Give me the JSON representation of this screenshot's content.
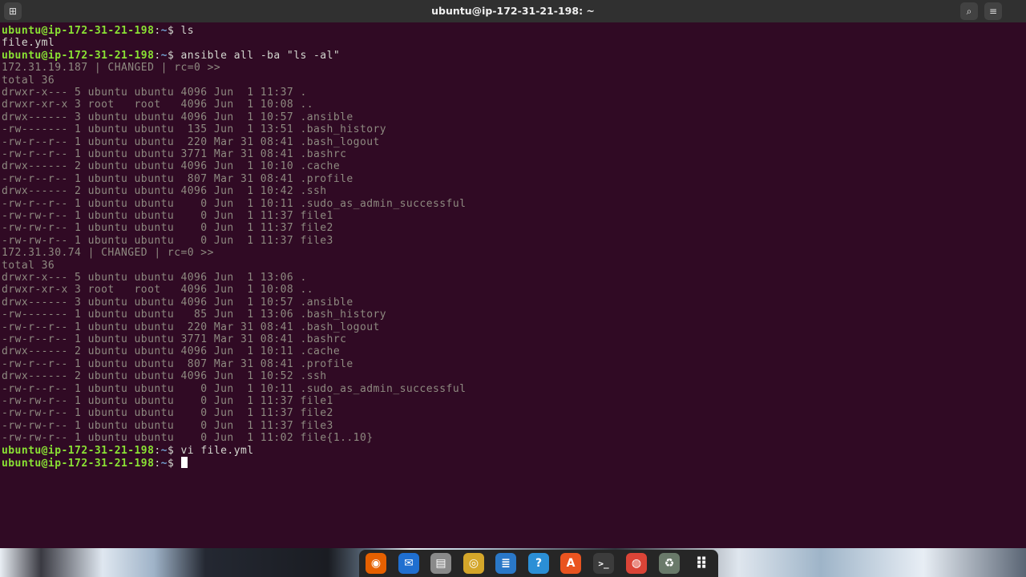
{
  "window": {
    "title": "ubuntu@ip-172-31-21-198: ~"
  },
  "terminal": {
    "prompt_user": "ubuntu@ip-172-31-21-198",
    "prompt_sep": ":",
    "prompt_path": "~",
    "prompt_symbol": "$",
    "commands": {
      "ls": " ls",
      "ansible": " ansible all -ba \"ls -al\"",
      "vi": " vi file.yml"
    },
    "ls_output": "file.yml",
    "host1_header": "172.31.19.187 | CHANGED | rc=0 >>",
    "host1_total": "total 36",
    "host1_lines": [
      "drwxr-x--- 5 ubuntu ubuntu 4096 Jun  1 11:37 .",
      "drwxr-xr-x 3 root   root   4096 Jun  1 10:08 ..",
      "drwx------ 3 ubuntu ubuntu 4096 Jun  1 10:57 .ansible",
      "-rw------- 1 ubuntu ubuntu  135 Jun  1 13:51 .bash_history",
      "-rw-r--r-- 1 ubuntu ubuntu  220 Mar 31 08:41 .bash_logout",
      "-rw-r--r-- 1 ubuntu ubuntu 3771 Mar 31 08:41 .bashrc",
      "drwx------ 2 ubuntu ubuntu 4096 Jun  1 10:10 .cache",
      "-rw-r--r-- 1 ubuntu ubuntu  807 Mar 31 08:41 .profile",
      "drwx------ 2 ubuntu ubuntu 4096 Jun  1 10:42 .ssh",
      "-rw-r--r-- 1 ubuntu ubuntu    0 Jun  1 10:11 .sudo_as_admin_successful",
      "-rw-rw-r-- 1 ubuntu ubuntu    0 Jun  1 11:37 file1",
      "-rw-rw-r-- 1 ubuntu ubuntu    0 Jun  1 11:37 file2",
      "-rw-rw-r-- 1 ubuntu ubuntu    0 Jun  1 11:37 file3"
    ],
    "host2_header": "172.31.30.74 | CHANGED | rc=0 >>",
    "host2_total": "total 36",
    "host2_lines": [
      "drwxr-x--- 5 ubuntu ubuntu 4096 Jun  1 13:06 .",
      "drwxr-xr-x 3 root   root   4096 Jun  1 10:08 ..",
      "drwx------ 3 ubuntu ubuntu 4096 Jun  1 10:57 .ansible",
      "-rw------- 1 ubuntu ubuntu   85 Jun  1 13:06 .bash_history",
      "-rw-r--r-- 1 ubuntu ubuntu  220 Mar 31 08:41 .bash_logout",
      "-rw-r--r-- 1 ubuntu ubuntu 3771 Mar 31 08:41 .bashrc",
      "drwx------ 2 ubuntu ubuntu 4096 Jun  1 10:11 .cache",
      "-rw-r--r-- 1 ubuntu ubuntu  807 Mar 31 08:41 .profile",
      "drwx------ 2 ubuntu ubuntu 4096 Jun  1 10:52 .ssh",
      "-rw-r--r-- 1 ubuntu ubuntu    0 Jun  1 10:11 .sudo_as_admin_successful",
      "-rw-rw-r-- 1 ubuntu ubuntu    0 Jun  1 11:37 file1",
      "-rw-rw-r-- 1 ubuntu ubuntu    0 Jun  1 11:37 file2",
      "-rw-rw-r-- 1 ubuntu ubuntu    0 Jun  1 11:37 file3",
      "-rw-rw-r-- 1 ubuntu ubuntu    0 Jun  1 11:02 file{1..10}"
    ]
  },
  "dock": {
    "apps": [
      {
        "icon": "firefox-icon",
        "glyph": "◉",
        "color": "#e66000"
      },
      {
        "icon": "thunderbird-icon",
        "glyph": "✉",
        "color": "#1f6fd0"
      },
      {
        "icon": "files-icon",
        "glyph": "▤",
        "color": "#8a8a8a"
      },
      {
        "icon": "rhythmbox-icon",
        "glyph": "◎",
        "color": "#d4a62a"
      },
      {
        "icon": "writer-icon",
        "glyph": "≣",
        "color": "#2a78c8"
      },
      {
        "icon": "help-icon",
        "glyph": "?",
        "color": "#2b8fd6"
      },
      {
        "icon": "software-icon",
        "glyph": "A",
        "color": "#e95420"
      },
      {
        "icon": "terminal-icon",
        "glyph": ">_",
        "color": "#3c3c3c"
      },
      {
        "icon": "chrome-icon",
        "glyph": "◍",
        "color": "#db4437"
      },
      {
        "icon": "trash-icon",
        "glyph": "♻",
        "color": "#6a7a6a"
      },
      {
        "icon": "show-apps-icon",
        "glyph": "⠿",
        "color": "#262626"
      }
    ]
  },
  "colors": {
    "background": "#300a24",
    "prompt_user": "#8ae234",
    "prompt_path": "#729fcf",
    "text": "#d3d7cf"
  }
}
